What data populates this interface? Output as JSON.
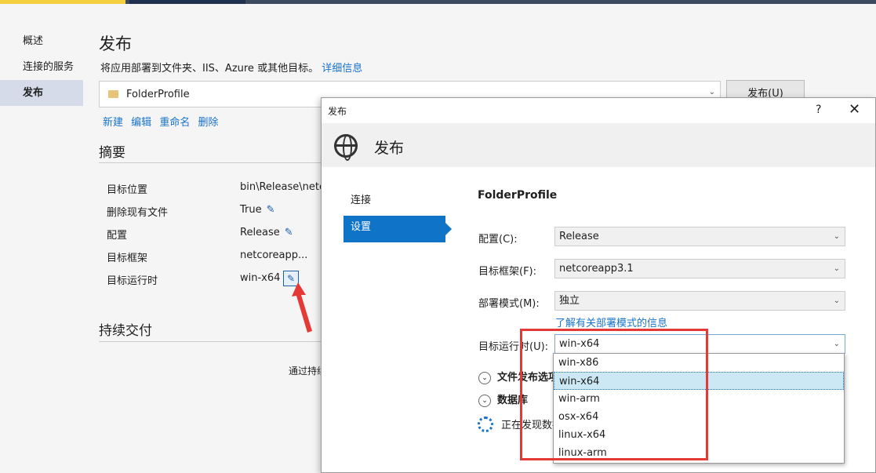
{
  "sidebar": {
    "items": [
      {
        "label": "概述"
      },
      {
        "label": "连接的服务"
      },
      {
        "label": "发布"
      }
    ]
  },
  "main": {
    "title": "发布",
    "description": "将应用部署到文件夹、IIS、Azure 或其他目标。",
    "details_link": "详细信息",
    "profile": "FolderProfile",
    "publish_button": "发布(U)",
    "actions": [
      "新建",
      "编辑",
      "重命名",
      "删除"
    ],
    "summary_title": "摘要",
    "summary": [
      {
        "label": "目标位置",
        "value": "bin\\Release\\netc"
      },
      {
        "label": "删除现有文件",
        "value": "True"
      },
      {
        "label": "配置",
        "value": "Release"
      },
      {
        "label": "目标框架",
        "value": "netcoreapp..."
      },
      {
        "label": "目标运行时",
        "value": "win-x64"
      }
    ],
    "cd_title": "持续交付",
    "cd_text": "通过持续"
  },
  "dialog": {
    "title": "发布",
    "help": "?",
    "close": "✕",
    "heading": "发布",
    "nav": [
      {
        "label": "连接"
      },
      {
        "label": "设置"
      }
    ],
    "profile_name": "FolderProfile",
    "fields": {
      "config": {
        "label": "配置(C):",
        "value": "Release"
      },
      "framework": {
        "label": "目标框架(F):",
        "value": "netcoreapp3.1"
      },
      "deploy": {
        "label": "部署模式(M):",
        "value": "独立"
      },
      "runtime": {
        "label": "目标运行时(U):",
        "value": "win-x64"
      }
    },
    "deploy_link": "了解有关部署模式的信息",
    "expanders": {
      "file_options": "文件发布选项",
      "database": "数据库"
    },
    "discovering": "正在发现数据",
    "runtime_options": [
      "win-x86",
      "win-x64",
      "win-arm",
      "osx-x64",
      "linux-x64",
      "linux-arm"
    ],
    "runtime_selected_index": 1
  },
  "colors": {
    "accent": "#0f74c8",
    "highlight_box": "#e53935",
    "link": "#1a73c9"
  }
}
